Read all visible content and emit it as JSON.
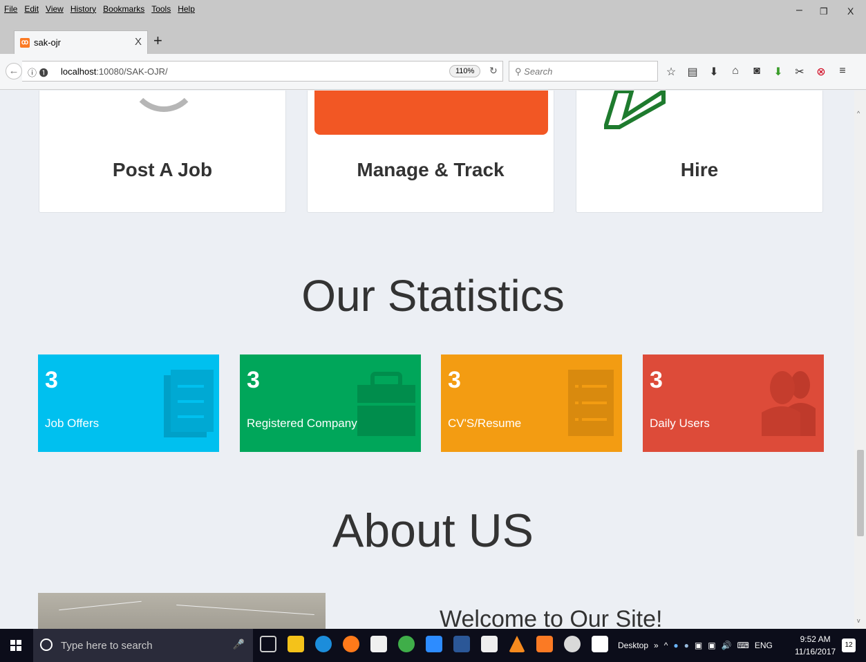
{
  "menubar": {
    "items": [
      "File",
      "Edit",
      "View",
      "History",
      "Bookmarks",
      "Tools",
      "Help"
    ],
    "window_controls": [
      "–",
      "❐",
      "X"
    ]
  },
  "tab": {
    "title": "sak-ojr",
    "favicon": "xampp-icon",
    "close": "X"
  },
  "newtab_label": "+",
  "navbar": {
    "url_host": "localhost",
    "url_rest": ":10080/SAK-OJR/",
    "zoom": "110%",
    "search_placeholder": "Search"
  },
  "services": {
    "items": [
      {
        "label": "Post A Job"
      },
      {
        "label": "Manage & Track"
      },
      {
        "label": "Hire"
      }
    ]
  },
  "statistics": {
    "title": "Our Statistics",
    "items": [
      {
        "count": "3",
        "label": "Job Offers",
        "color": "#00c0ef",
        "icon": "document-icon"
      },
      {
        "count": "3",
        "label": "Registered Company",
        "color": "#00a65a",
        "icon": "briefcase-icon"
      },
      {
        "count": "3",
        "label": "CV'S/Resume",
        "color": "#f39c12",
        "icon": "list-icon"
      },
      {
        "count": "3",
        "label": "Daily Users",
        "color": "#dd4b39",
        "icon": "users-icon"
      }
    ]
  },
  "about": {
    "title": "About US",
    "welcome": "Welcome to Our Site!"
  },
  "taskbar": {
    "search_placeholder": "Type here to search",
    "desktop_label": "Desktop",
    "overflow": "»",
    "language": "ENG",
    "time": "9:52 AM",
    "date": "11/16/2017",
    "notification_count": "12"
  }
}
